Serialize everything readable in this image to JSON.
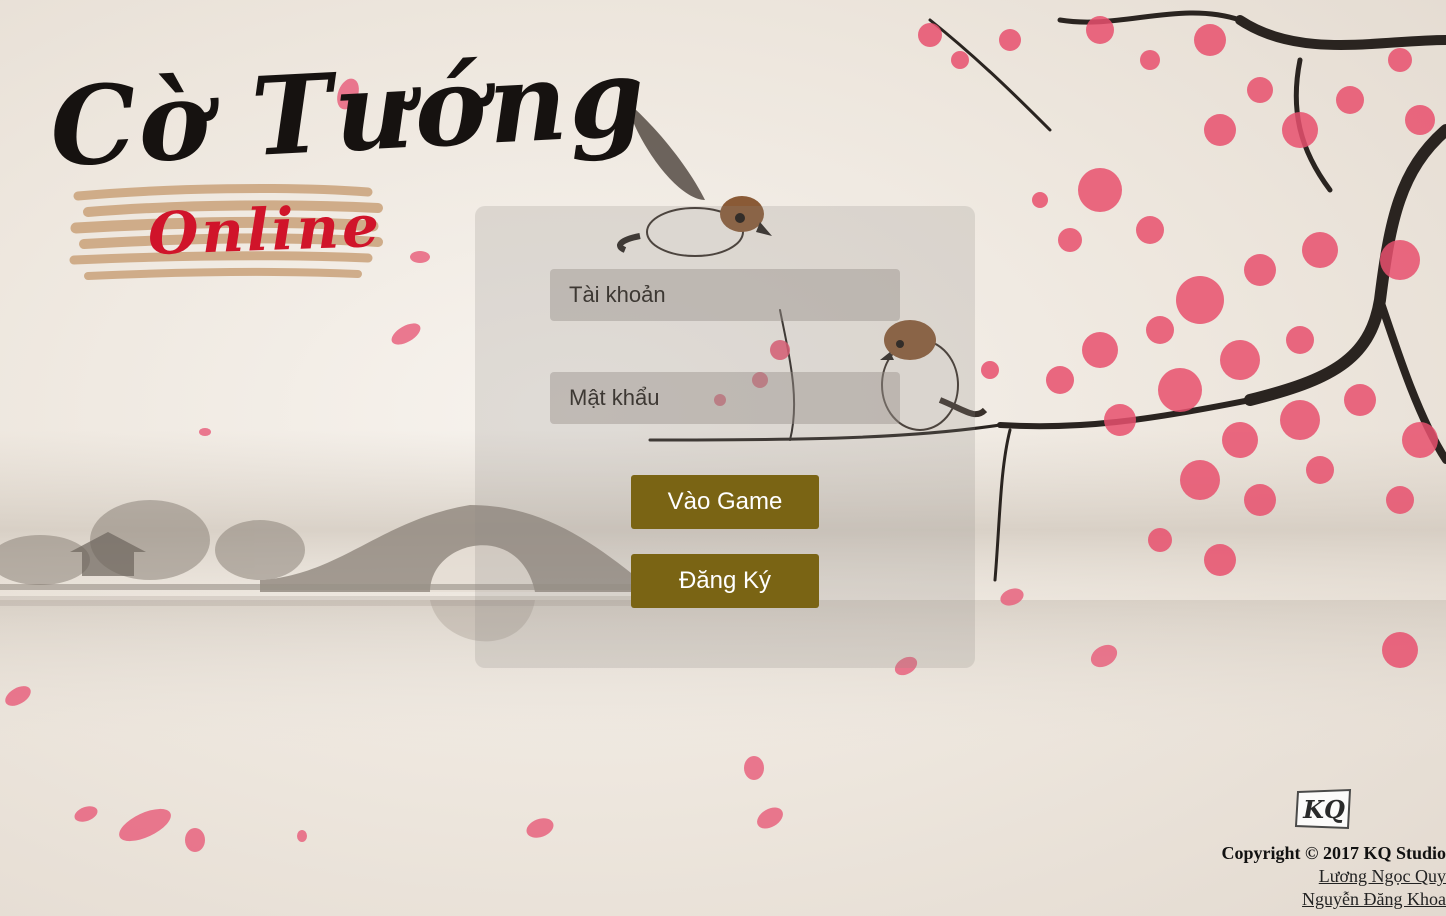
{
  "logo": {
    "title": "Cờ Tướng",
    "subtitle": "Online"
  },
  "login": {
    "username_placeholder": "Tài khoản",
    "password_placeholder": "Mật khẩu",
    "username_value": "",
    "password_value": "",
    "login_button": "Vào Game",
    "register_button": "Đăng Ký"
  },
  "footer": {
    "studio_logo_text": "KQ",
    "copyright": "Copyright © 2017 KQ Studio",
    "authors": [
      "Lương Ngọc Quy",
      "Nguyễn Đăng Khoa"
    ]
  },
  "colors": {
    "button_bg": "#7a6414",
    "button_text": "#ffffff",
    "blossom": "#e8506e",
    "logo_red": "#d0142a",
    "ink": "#161210"
  },
  "icons": {
    "background": "ink-painting-bridge-and-plum-blossom",
    "birds": "sparrow-icon",
    "studio": "kq-studio-logo"
  }
}
